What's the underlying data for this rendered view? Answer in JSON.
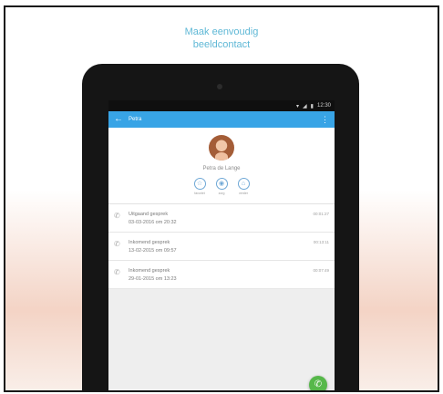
{
  "promo": {
    "line1": "Maak eenvoudig",
    "line2": "beeldcontact"
  },
  "statusbar": {
    "time": "12:30"
  },
  "appbar": {
    "title": "Petra",
    "back_icon": "arrow-left-icon",
    "menu_icon": "overflow-menu-icon"
  },
  "contact": {
    "name": "Petra de Lange",
    "actions": [
      {
        "label": "favoriet",
        "icon": "star-icon"
      },
      {
        "label": "zorg",
        "icon": "eye-icon"
      },
      {
        "label": "verder",
        "icon": "car-icon"
      }
    ]
  },
  "calls": [
    {
      "type": "Uitgaand gesprek",
      "date": "03-03-2016 om 20:32",
      "duration": "00:01:27"
    },
    {
      "type": "Inkomend gesprek",
      "date": "13-02-2015 om 09:57",
      "duration": "00:13:11"
    },
    {
      "type": "Inkomend gesprek",
      "date": "29-01-2015 om 13:23",
      "duration": "00:07:49"
    }
  ],
  "colors": {
    "accent": "#38a4e6",
    "fab": "#56b84a",
    "promo_text": "#5fb8d6"
  }
}
